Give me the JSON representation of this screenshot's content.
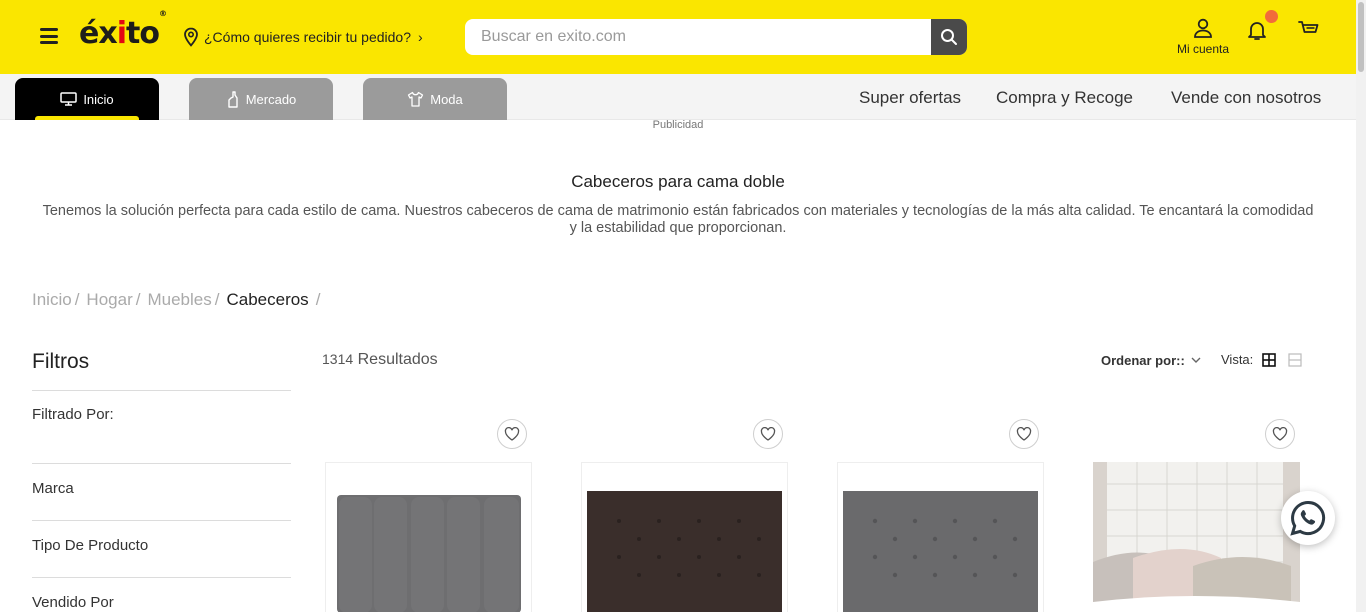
{
  "header": {
    "logo": {
      "text_main": "éx",
      "text_dot": "i",
      "text_end": "to",
      "registered": "®"
    },
    "delivery_prompt": "¿Cómo quieres recibir tu pedido?",
    "search_placeholder": "Buscar en exito.com",
    "account_label": "Mi cuenta",
    "colors": {
      "brand_yellow": "#fae600",
      "badge": "#f26b3a"
    }
  },
  "nav": {
    "tabs": [
      {
        "label": "Inicio",
        "icon": "monitor-icon",
        "active": true
      },
      {
        "label": "Mercado",
        "icon": "bottle-icon",
        "active": false
      },
      {
        "label": "Moda",
        "icon": "shirt-icon",
        "active": false
      }
    ],
    "links": [
      "Super ofertas",
      "Compra y Recoge",
      "Vende con nosotros"
    ]
  },
  "content": {
    "ad_label": "Publicidad",
    "category_title": "Cabeceros para cama doble",
    "category_description": "Tenemos la solución perfecta para cada estilo de cama. Nuestros cabeceros de cama de matrimonio están fabricados con materiales y tecnologías de la más alta calidad. Te encantará la comodidad y la estabilidad que proporcionan.",
    "breadcrumb": [
      "Inicio",
      "Hogar",
      "Muebles",
      "Cabeceros"
    ],
    "breadcrumb_sep": "/"
  },
  "filters": {
    "title": "Filtros",
    "filtered_by": "Filtrado Por:",
    "groups": [
      "Marca",
      "Tipo De Producto",
      "Vendido Por"
    ]
  },
  "results": {
    "count": "1314",
    "label": "Resultados",
    "sort_label": "Ordenar por::",
    "view_label": "Vista:"
  },
  "products": [
    {
      "style": "gray-vertical-panels"
    },
    {
      "style": "dark-brown-tufted"
    },
    {
      "style": "dark-gray-tufted"
    },
    {
      "style": "white-tufted-bedroom"
    }
  ]
}
